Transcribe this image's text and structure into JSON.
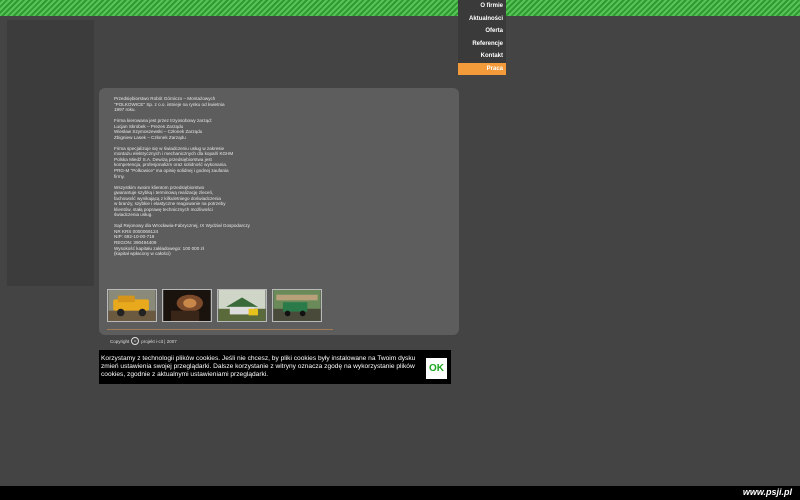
{
  "nav": {
    "items": [
      {
        "label": "O firmie",
        "active": false
      },
      {
        "label": "Aktualności",
        "active": false
      },
      {
        "label": "Oferta",
        "active": false
      },
      {
        "label": "Referencje",
        "active": false
      },
      {
        "label": "Kontakt",
        "active": false
      },
      {
        "label": "Praca",
        "active": true
      }
    ],
    "active_color": "#f39a3a"
  },
  "about": {
    "paragraphs": [
      "Przedsiębiorstwo Robót Górniczo – Montażowych\n\"POLKOWICE\" Sp. z o.o. istnieje na rynku od kwietnia\n1997 roku.",
      "Firma kierowana jest przez trzyosobowy zarząd:\nLucjan Skrobek – Prezes Zarządu\nWiesław Szymoszewski – Członek Zarządu\nZbigniew Lasek – Członek Zarządu",
      "Firma specjalizuje się w świadczeniu usług w zakresie\nmontażu elektrycznych i mechanicznych dla kopalń KGHM\nPolska Miedź S.A. Dewizą przedsiębiorstwa jest\nkompetencja, profesjonalizm oraz solidność wykonania.\nPRG-M \"Polkowice\" ma opinię solidnej i godnej zaufania\nfirmy.",
      "Wszystkim swoim klientom przedsiębiorstwo\ngwarantuje szybką i terminową realizację zleceń,\nfachowość wynikającą z kilkuletniego doświadczenia\nw branży, szybkie i elastyczne reagowanie na potrzeby\nklientów, stałą poprawę technicznych możliwości\nświadczenia usług.",
      "Sąd Rejonowy dla Wrocławia-Fabrycznej, IX Wydział Gospodarczy\nNR KRS 0000069124\nNIP: 692-10-00-719\nREGON: 390494409\nWysokość kapitału zakładowego: 100 000 zł\n(kapitał wpłacony w całości)"
    ]
  },
  "gallery": {
    "thumbnails": [
      {
        "name": "yellow-mining-vehicle-photo"
      },
      {
        "name": "underground-tunnel-photo"
      },
      {
        "name": "construction-site-photo"
      },
      {
        "name": "green-truck-photo"
      }
    ]
  },
  "copyright": {
    "prefix": "Copyright",
    "icon": "copyright-icon",
    "suffix": "projekt i-cit | 2007"
  },
  "cookie": {
    "text": "Korzystamy z technologii plików cookies. Jeśli nie chcesz, by pliki cookies były instalowane na Twoim dysku zmień ustawienia swojej przeglądarki. Dalsze korzystanie z witryny oznacza zgodę na wykorzystanie plików cookies, zgodnie z aktualnymi ustawieniami przeglądarki.",
    "ok_label": "OK",
    "ok_color": "#1ea51e"
  },
  "footer": {
    "brand": "www.psji.pl"
  }
}
